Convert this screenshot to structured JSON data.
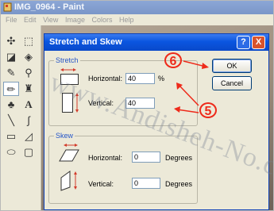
{
  "window": {
    "title": "IMG_0964 - Paint",
    "menu": [
      "File",
      "Edit",
      "View",
      "Image",
      "Colors",
      "Help"
    ]
  },
  "dialog": {
    "title": "Stretch and Skew",
    "help_label": "?",
    "close_label": "X",
    "stretch": {
      "legend": "Stretch",
      "horizontal_label": "Horizontal:",
      "horizontal_value": "40",
      "horizontal_unit": "%",
      "vertical_label": "Vertical:",
      "vertical_value": "40"
    },
    "skew": {
      "legend": "Skew",
      "horizontal_label": "Horizontal:",
      "horizontal_value": "0",
      "horizontal_unit": "Degrees",
      "vertical_label": "Vertical:",
      "vertical_value": "0",
      "vertical_unit": "Degrees"
    },
    "ok_label": "OK",
    "cancel_label": "Cancel"
  },
  "annotations": {
    "marker_6": "6",
    "marker_5": "5",
    "accent": "#ee2a1a"
  },
  "watermark": "www.Andisheh-No.com"
}
